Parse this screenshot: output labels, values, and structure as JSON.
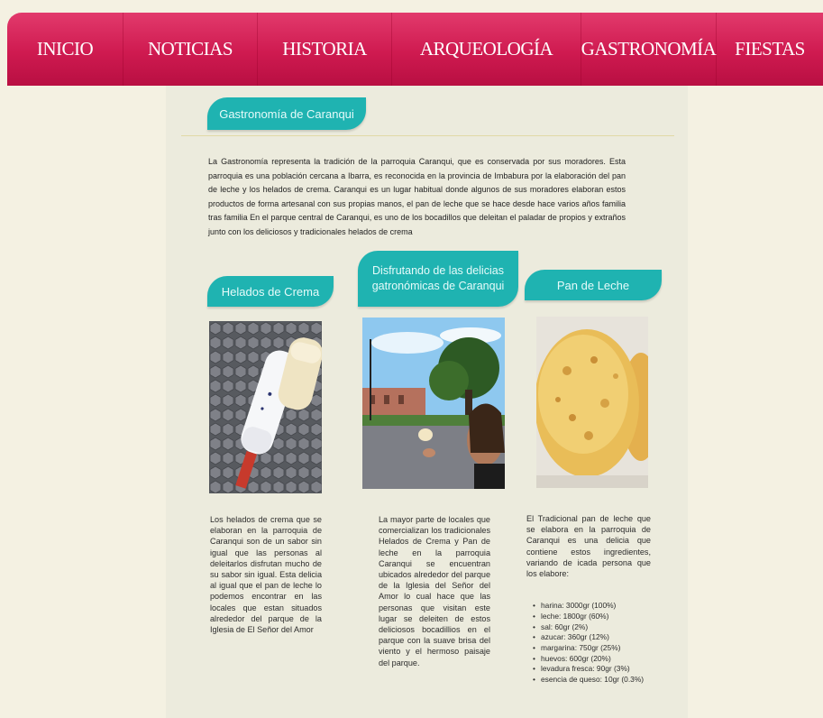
{
  "nav": {
    "items": [
      {
        "label": "INICIO"
      },
      {
        "label": "NOTICIAS"
      },
      {
        "label": "HISTORIA"
      },
      {
        "label": "ARQUEOLOGÍA"
      },
      {
        "label": "GASTRONOMÍA"
      },
      {
        "label": "FIESTAS"
      }
    ]
  },
  "page": {
    "title": "Gastronomía de Caranqui",
    "intro": "La Gastronomía representa la tradición de la parroquia Caranqui, que es conservada por sus moradores. Esta parroquia es una población cercana a Ibarra, es reconocida en la provincia de Imbabura por la elaboración del pan de leche y los helados de crema. Caranqui es un lugar habitual donde algunos de sus moradores elaboran estos productos de forma artesanal con sus propias manos, el pan de leche que se hace desde hace varios años familia tras familia En el parque central de Caranqui, es uno de los bocadillos que deleitan el paladar de propios y extraños junto con los deliciosos y tradicionales helados de crema"
  },
  "columns": {
    "helados": {
      "title": "Helados de Crema",
      "text": "Los helados de crema que se elaboran en la parroquia de Caranqui son de un sabor sin igual que las personas al deleitarlos disfrutan mucho de su sabor sin igual. Esta delicia al igual que el pan de leche lo podemos encontrar en las locales que estan situados alrededor del parque de la Iglesia de El Señor del Amor"
    },
    "delicias": {
      "title": "Disfrutando de las delicias gatronómicas de Caranqui",
      "text": "La mayor parte de locales que comercializan los tradicionales Helados de Crema y Pan de leche en la parroquia Caranqui se encuentran ubicados alrededor del parque de la Iglesia del Señor del Amor lo cual hace que las personas que visitan este lugar se deleiten de estos deliciosos bocadillios en el parque con la suave brisa del viento y el hermoso paisaje del parque."
    },
    "pan": {
      "title": "Pan de Leche",
      "text": "El Tradicional pan de leche que se elabora en la parroquia de Caranqui es una delicia que contiene estos ingredientes, variando de icada persona que los elabore:",
      "ingredients": [
        "harina: 3000gr (100%)",
        "leche: 1800gr (60%)",
        "sal: 60gr (2%)",
        "azucar: 360gr (12%)",
        "margarina: 750gr (25%)",
        "huevos: 600gr (20%)",
        "levadura fresca: 90gr (3%)",
        "esencia de queso: 10gr (0.3%)"
      ]
    }
  },
  "colors": {
    "nav": "#cf1a50",
    "accent": "#1fb3b1",
    "page_bg": "#f4f1e2",
    "content_bg": "#ecebdd"
  }
}
